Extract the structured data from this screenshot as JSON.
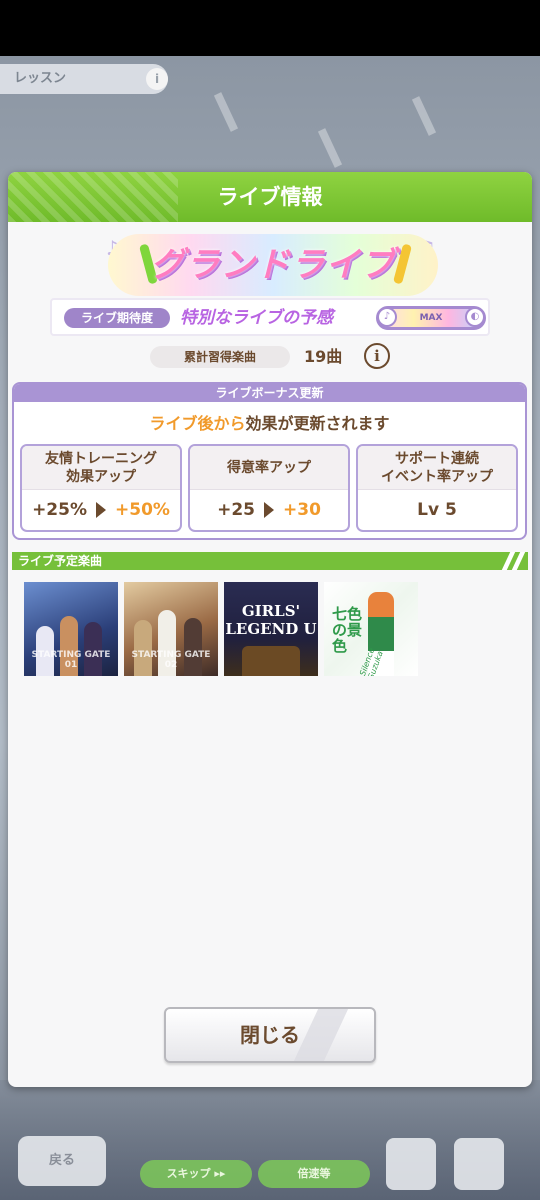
{
  "background": {
    "lesson_label": "レッスン",
    "lesson_icon": "info-icon",
    "back_label": "戻る",
    "skip_label": "スキップ ▸▸",
    "skip2_label": "倍速等"
  },
  "dialog": {
    "title": "ライブ情報",
    "banner_title": "グランドライブ",
    "expectation": {
      "label": "ライブ期待度",
      "value": "特別なライブの予感",
      "meter_label": "MAX",
      "meter_level": 1.0
    },
    "learned": {
      "label": "累計習得楽曲",
      "value": "19曲"
    },
    "bonus": {
      "header": "ライブボーナス更新",
      "subtitle_pre": "ライブ後から",
      "subtitle_mid": "効果",
      "subtitle_post": "が更新されます",
      "cards": [
        {
          "title": "友情トレーニング\n効果アップ",
          "before": "+25%",
          "after": "+50%"
        },
        {
          "title": "得意率アップ",
          "before": "+25",
          "after": "+30"
        },
        {
          "title": "サポート連続\nイベント率アップ",
          "value": "Lv 5"
        }
      ]
    },
    "songs": {
      "header": "ライブ予定楽曲",
      "items": [
        {
          "caption": "STARTING GATE 01"
        },
        {
          "caption": "STARTING GATE 02"
        },
        {
          "caption": "GIRLS' LEGEND U"
        },
        {
          "caption": "七色の景色",
          "subcaption": "Silence Suzuka"
        }
      ]
    },
    "close_label": "閉じる"
  },
  "colors": {
    "header_green": "#7cc634",
    "accent_purple": "#a994d4",
    "accent_orange": "#f19a2b",
    "text_brown": "#6b4a2e"
  }
}
